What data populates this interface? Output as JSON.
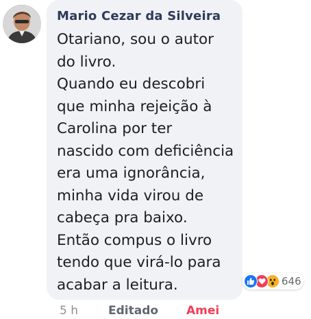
{
  "comment": {
    "author": "Mario Cezar da Silveira",
    "body_lines": [
      "Otariano, sou o autor",
      "do livro.",
      "Quando eu descobri",
      "que minha rejeição à",
      "Carolina por ter",
      "nascido com deficiência",
      "era uma ignorância,",
      "minha vida virou de",
      "cabeça pra baixo.",
      "Então compus o livro",
      "tendo que virá-lo para",
      "acabar a leitura."
    ]
  },
  "reactions": {
    "icons": [
      "like-icon",
      "love-icon",
      "wow-icon"
    ],
    "count": "646"
  },
  "meta": {
    "time": "5 h",
    "edited": "Editado",
    "reaction_action": "Amei"
  },
  "colors": {
    "bubble": "#f1f2f6",
    "author": "#2e3a59",
    "love": "#f33e58",
    "like": "#1877f2",
    "wow": "#f7b125"
  }
}
